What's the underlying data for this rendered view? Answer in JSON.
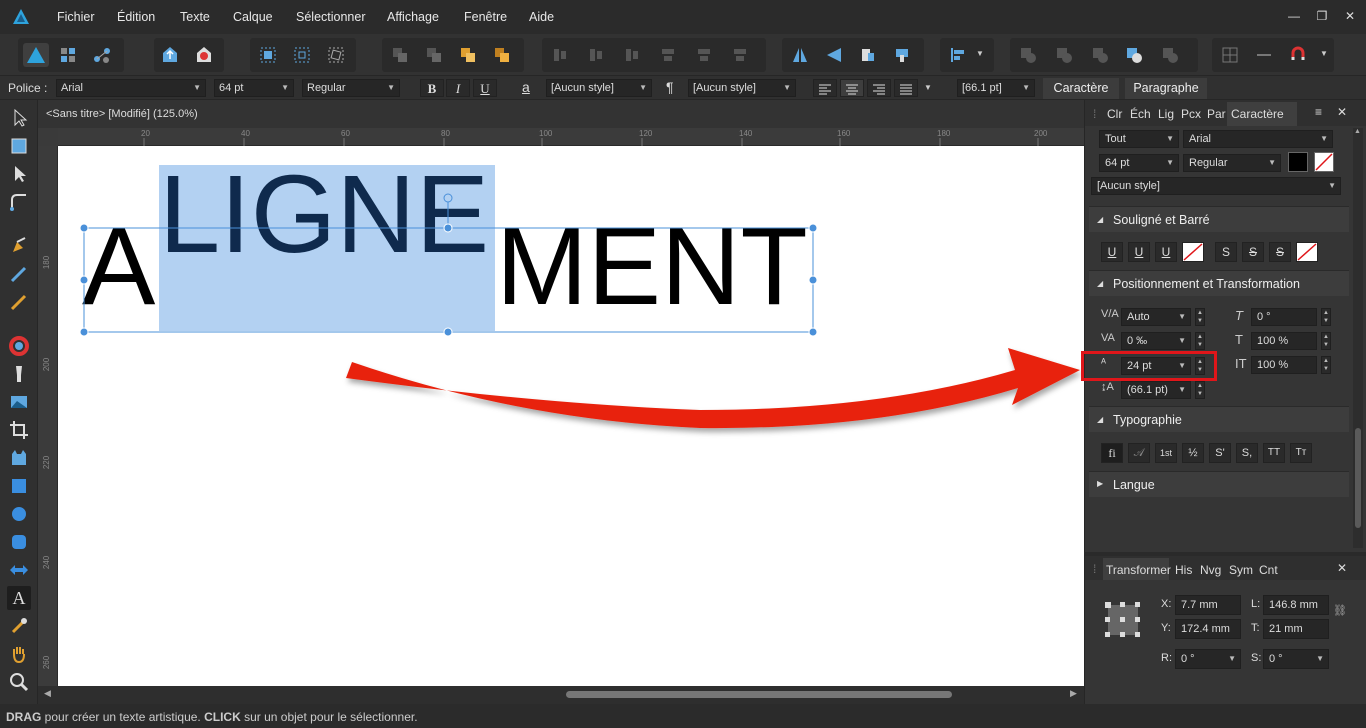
{
  "menubar": {
    "items": [
      "Fichier",
      "Édition",
      "Texte",
      "Calque",
      "Sélectionner",
      "Affichage",
      "Fenêtre",
      "Aide"
    ]
  },
  "contextbar": {
    "font_label": "Police :",
    "font_family": "Arial",
    "font_size": "64 pt",
    "font_style": "Regular",
    "bold": "B",
    "italic": "I",
    "underline": "U",
    "char_style_icon": "a",
    "char_style": "[Aucun style]",
    "para_icon": "¶",
    "para_style": "[Aucun style]",
    "leading": "[66.1 pt]",
    "tab_character": "Caractère",
    "tab_paragraph": "Paragraphe"
  },
  "document": {
    "tab_title": "<Sans titre> [Modifié] (125.0%)",
    "ruler_h": [
      "20",
      "40",
      "60",
      "80",
      "100",
      "120",
      "140",
      "160",
      "180",
      "200"
    ],
    "ruler_v": [
      "180",
      "200",
      "220",
      "240",
      "260"
    ],
    "text_a": "A",
    "text_ligne": "LIGNE",
    "text_ment": "MENT"
  },
  "char_panel": {
    "tabs": [
      "Clr",
      "Éch",
      "Lig",
      "Pcx",
      "Par",
      "Caractère"
    ],
    "scope": "Tout",
    "family": "Arial",
    "size": "64 pt",
    "style": "Regular",
    "char_style": "[Aucun style]",
    "section_underline": "Souligné et Barré",
    "underline_buttons": [
      "U",
      "U",
      "U",
      "S",
      "S",
      "S"
    ],
    "section_position": "Positionnement et Transformation",
    "kerning": "Auto",
    "tracking": "0 ‰",
    "baseline": "24 pt",
    "leading": "(66.1 pt)",
    "skew": "0 °",
    "vscale": "100 %",
    "hscale": "100 %",
    "section_typo": "Typographie",
    "typo_buttons": [
      "fi",
      "𝒜",
      "1st",
      "½",
      "S'",
      "S,",
      "TT",
      "Tт"
    ],
    "section_lang": "Langue"
  },
  "transform_panel": {
    "tabs": [
      "Transformer",
      "His",
      "Nvg",
      "Sym",
      "Cnt"
    ],
    "x_label": "X:",
    "x": "7.7 mm",
    "y_label": "Y:",
    "y": "172.4 mm",
    "w_label": "L:",
    "w": "146.8 mm",
    "h_label": "T:",
    "h": "21 mm",
    "r_label": "R:",
    "r": "0 °",
    "s_label": "S:",
    "s": "0 °"
  },
  "status": {
    "drag": "DRAG",
    "drag_text": " pour créer un texte artistique. ",
    "click": "CLICK",
    "click_text": " sur un objet pour le sélectionner."
  },
  "colors": {
    "accent": "#4a90d9",
    "selection": "#b3d1f2",
    "arrow": "#e8240e",
    "highlight_box": "#e0161a",
    "active_tab": "#3c3c3c"
  }
}
